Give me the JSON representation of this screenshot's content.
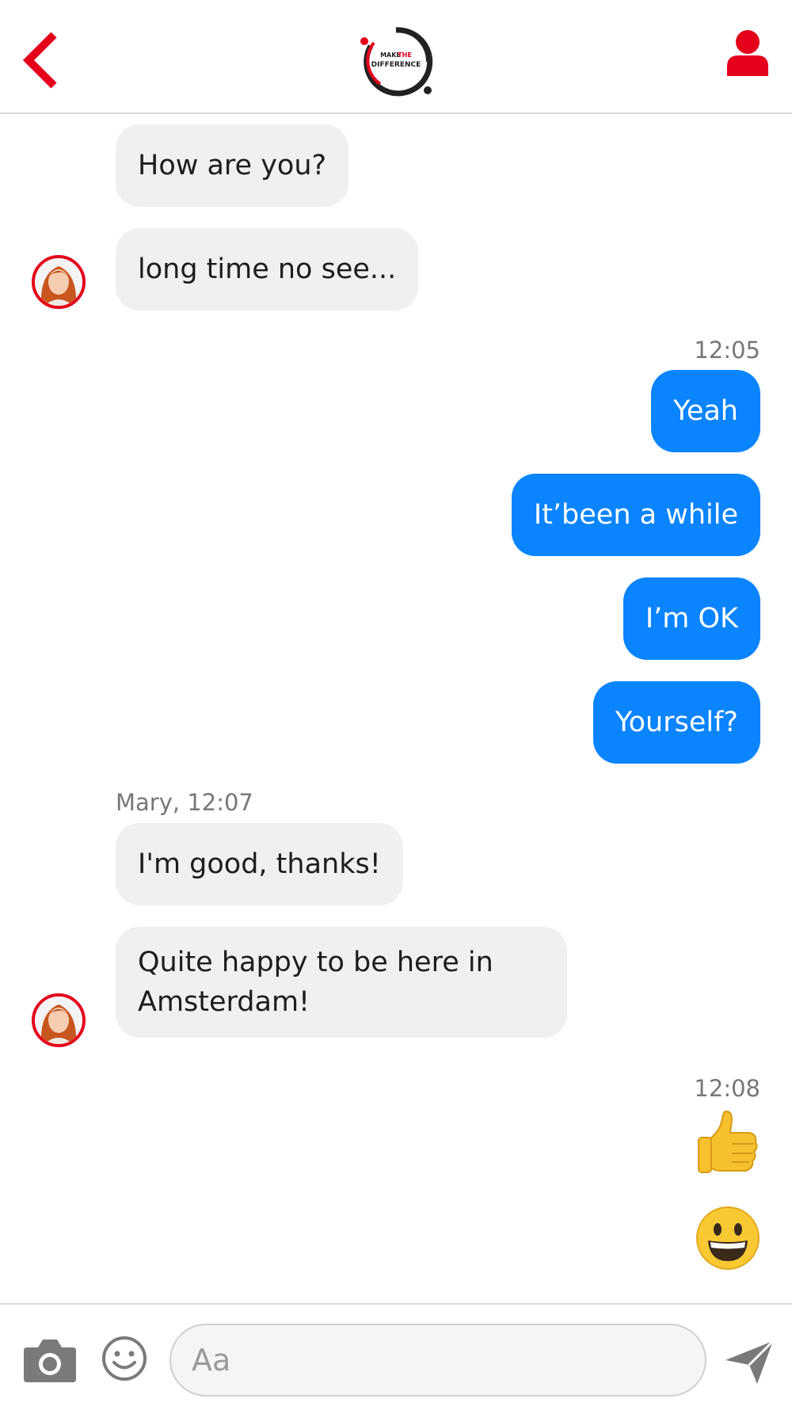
{
  "header": {
    "logo_line1_a": "MAKE",
    "logo_line1_b": "THE",
    "logo_line2": "DIFFERENCE"
  },
  "messages": {
    "m1": "How are you?",
    "m2": "long time no see...",
    "ts1": "12:05",
    "m3": "Yeah",
    "m4": "It’been a while",
    "m5": "I’m OK",
    "m6": "Yourself?",
    "sender1": "Mary, 12:07",
    "m7": "I'm good, thanks!",
    "m8": "Quite happy to be here in Amsterdam!",
    "ts2": "12:08"
  },
  "composer": {
    "placeholder": "Aa"
  },
  "icons": {
    "back": "chevron-left-icon",
    "profile": "user-icon",
    "camera": "camera-icon",
    "emoji": "smiley-icon",
    "send": "send-icon",
    "thumbs_up": "thumbs-up-emoji",
    "grin": "grinning-face-emoji"
  },
  "colors": {
    "brand_red": "#e4001b",
    "outgoing_bubble": "#0a84ff",
    "incoming_bubble": "#f0f0f0"
  }
}
